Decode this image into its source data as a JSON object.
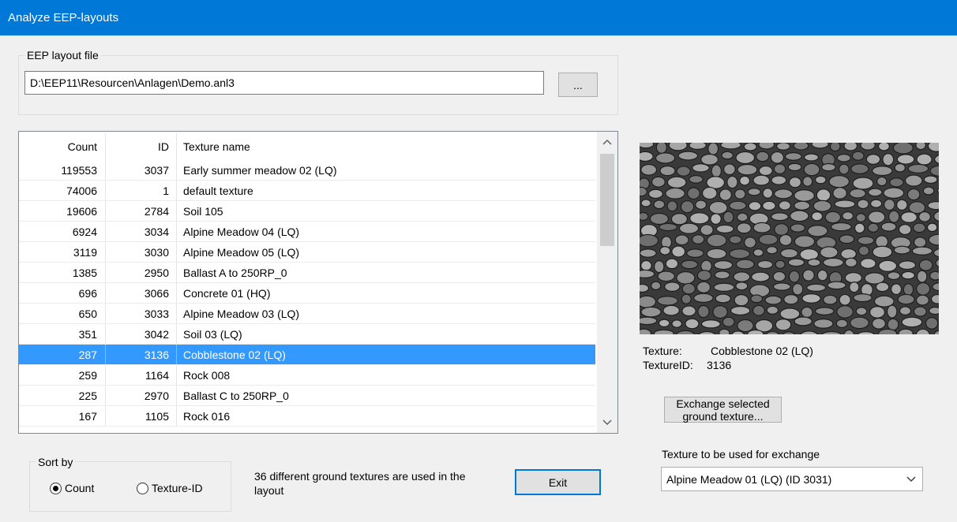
{
  "window": {
    "title": "Analyze EEP-layouts"
  },
  "file_group": {
    "legend": "EEP layout file",
    "path_value": "D:\\EEP11\\Resourcen\\Anlagen\\Demo.anl3",
    "browse_label": "..."
  },
  "list": {
    "columns": {
      "count": "Count",
      "id": "ID",
      "name": "Texture name"
    },
    "rows": [
      {
        "count": "119553",
        "id": "3037",
        "name": "Early summer meadow 02 (LQ)"
      },
      {
        "count": "74006",
        "id": "1",
        "name": "default texture"
      },
      {
        "count": "19606",
        "id": "2784",
        "name": "Soil 105"
      },
      {
        "count": "6924",
        "id": "3034",
        "name": "Alpine Meadow 04 (LQ)"
      },
      {
        "count": "3119",
        "id": "3030",
        "name": "Alpine Meadow 05 (LQ)"
      },
      {
        "count": "1385",
        "id": "2950",
        "name": "Ballast A to 250RP_0"
      },
      {
        "count": "696",
        "id": "3066",
        "name": "Concrete 01 (HQ)"
      },
      {
        "count": "650",
        "id": "3033",
        "name": "Alpine Meadow 03 (LQ)"
      },
      {
        "count": "351",
        "id": "3042",
        "name": "Soil 03 (LQ)"
      },
      {
        "count": "287",
        "id": "3136",
        "name": "Cobblestone 02 (LQ)"
      },
      {
        "count": "259",
        "id": "1164",
        "name": "Rock 008"
      },
      {
        "count": "225",
        "id": "2970",
        "name": "Ballast C to 250RP_0"
      },
      {
        "count": "167",
        "id": "1105",
        "name": "Rock 016"
      }
    ],
    "selected_index": 9
  },
  "texture_info": {
    "texture_label": "Texture:",
    "texture_name": "Cobblestone 02 (LQ)",
    "textureid_label": "TextureID:",
    "texture_id": "3136"
  },
  "exchange_button": "Exchange selected ground texture...",
  "exchange_combo": {
    "label": "Texture to be used for exchange",
    "selected": "Alpine Meadow 01 (LQ) (ID 3031)"
  },
  "sort_group": {
    "legend": "Sort by",
    "option_count": "Count",
    "option_textureid": "Texture-ID",
    "selected": "Count"
  },
  "summary_text": "36 different ground textures are used in the layout",
  "exit_label": "Exit",
  "colors": {
    "titlebar": "#0078d7",
    "selection": "#3399ff"
  }
}
